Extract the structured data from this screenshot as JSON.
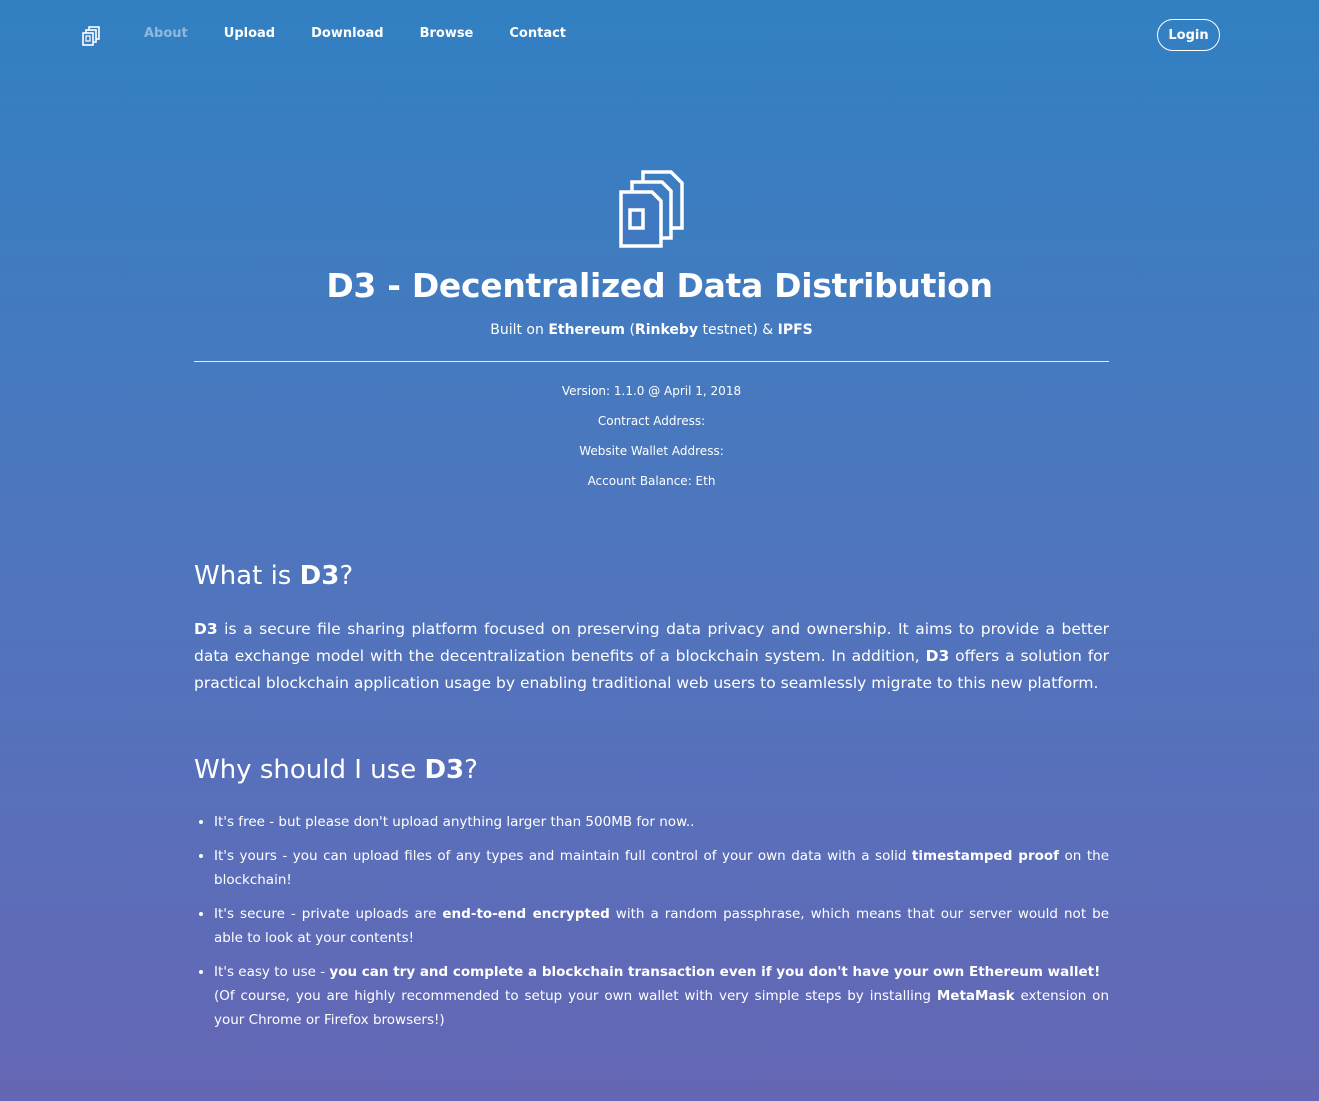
{
  "nav": {
    "logo_icon": "files-stack-icon",
    "links": [
      {
        "label": "About",
        "active": true
      },
      {
        "label": "Upload",
        "active": false
      },
      {
        "label": "Download",
        "active": false
      },
      {
        "label": "Browse",
        "active": false
      },
      {
        "label": "Contact",
        "active": false
      }
    ],
    "login_label": "Login"
  },
  "hero": {
    "logo_icon": "files-stack-icon",
    "title": "D3 - Decentralized Data Distribution",
    "subtitle": {
      "prefix": "Built on ",
      "ethereum": "Ethereum",
      "open_paren": " (",
      "rinkeby": "Rinkeby",
      "testnet": " testnet) & ",
      "ipfs": "IPFS"
    }
  },
  "meta": {
    "version": "Version: 1.1.0 @ April 1, 2018",
    "contract_address": "Contract Address:",
    "wallet_address": "Website Wallet Address:",
    "account_balance": "Account Balance: Eth"
  },
  "what": {
    "heading_prefix": "What is ",
    "heading_bold": "D3",
    "heading_suffix": "?",
    "p_bold1": "D3",
    "p_text1": " is a secure file sharing platform focused on preserving data privacy and ownership. It aims to provide a better data exchange model with the decentralization benefits of a blockchain system. In addition, ",
    "p_bold2": "D3",
    "p_text2": " offers a solution for practical blockchain application usage by enabling traditional web users to seamlessly migrate to this new platform."
  },
  "why": {
    "heading_prefix": "Why should I use ",
    "heading_bold": "D3",
    "heading_suffix": "?",
    "items": [
      {
        "text": "It's free - but please don't upload anything larger than 500MB for now.."
      },
      {
        "text1": "It's yours - you can upload files of any types and maintain full control of your own data with a solid ",
        "bold": "timestamped proof",
        "text2": " on the blockchain!"
      },
      {
        "text1": "It's secure - private uploads are ",
        "bold": "end-to-end encrypted",
        "text2": " with a random passphrase, which means that our server would not be able to look at your contents!"
      },
      {
        "text1": "It's easy to use - ",
        "bold": "you can try and complete a blockchain transaction even if you don't have your own Ethereum wallet!",
        "text2": "(Of course, you are highly recommended to setup your own wallet with very simple steps by installing ",
        "bold2": "MetaMask",
        "text3": " extension on your Chrome or Firefox browsers!)"
      }
    ]
  }
}
